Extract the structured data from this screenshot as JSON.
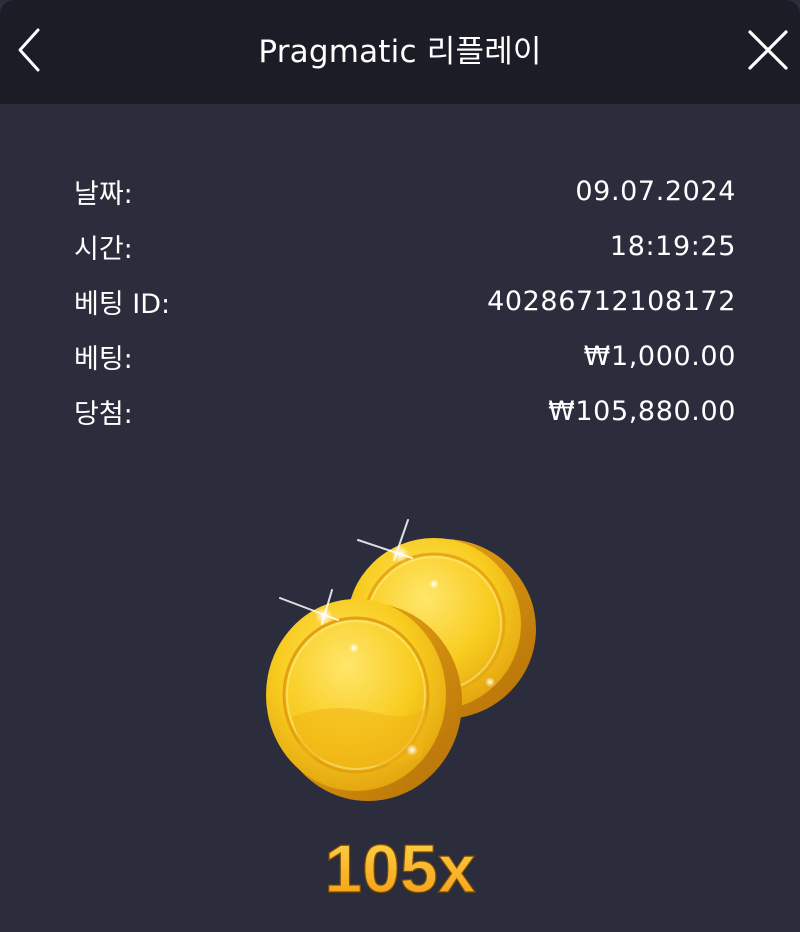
{
  "header": {
    "title": "Pragmatic 리플레이",
    "back_icon": "chevron-left-icon",
    "close_icon": "close-icon"
  },
  "details": {
    "date_label": "날짜:",
    "date_value": "09.07.2024",
    "time_label": "시간:",
    "time_value": "18:19:25",
    "bet_id_label": "베팅 ID:",
    "bet_id_value": "40286712108172",
    "bet_label": "베팅:",
    "bet_value": "₩1,000.00",
    "win_label": "당첨:",
    "win_value": "₩105,880.00"
  },
  "result": {
    "multiplier": "105x",
    "icon": "gold-coins-icon"
  },
  "colors": {
    "background": "#2b2d3c",
    "header": "#1b1c25",
    "text": "#ffffff",
    "coin": "#f6c21a",
    "multiplier": "#f7b31b"
  }
}
